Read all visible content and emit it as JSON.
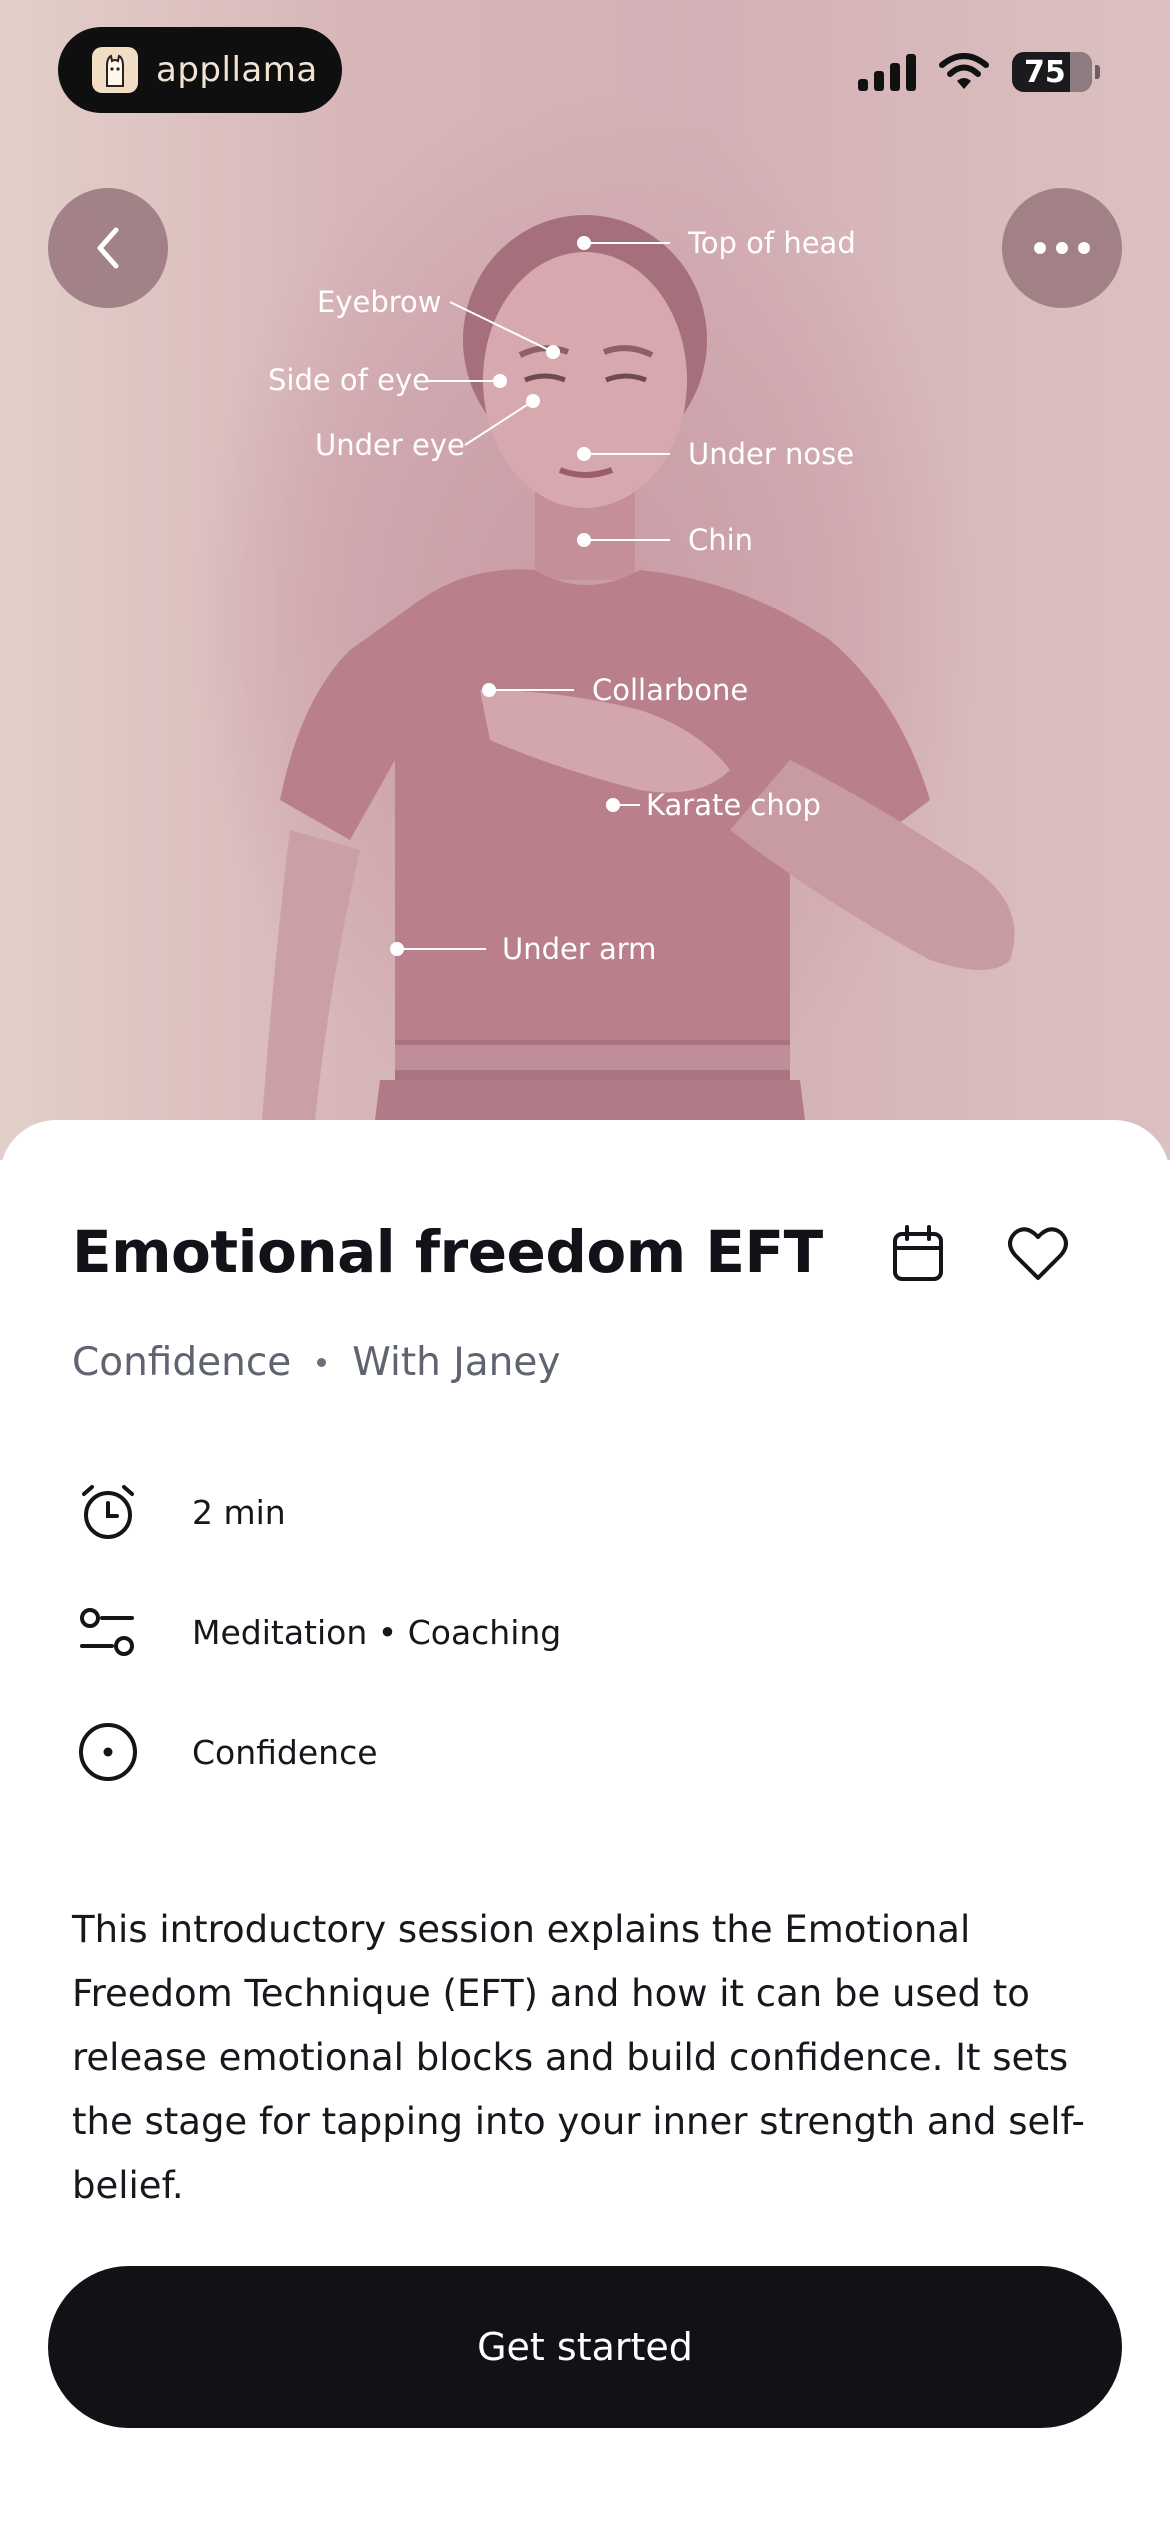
{
  "status_bar": {
    "brand": "appllama",
    "battery": "75"
  },
  "hero": {
    "tapping_points": [
      "Top of head",
      "Eyebrow",
      "Side of eye",
      "Under eye",
      "Under nose",
      "Chin",
      "Collarbone",
      "Karate chop",
      "Under arm"
    ]
  },
  "session": {
    "title": "Emotional freedom EFT",
    "category": "Confidence",
    "instructor": "With Janey",
    "duration": "2 min",
    "type": "Meditation • Coaching",
    "goal": "Confidence",
    "description": "This introductory session explains the Emotional Freedom Technique (EFT) and how it can be used to release emotional blocks and build confidence. It sets the stage for tapping into your inner strength and self-belief.",
    "cta": "Get started"
  },
  "icons": {
    "back": "chevron-left-icon",
    "more": "more-dots-icon",
    "calendar": "calendar-icon",
    "favorite": "heart-icon",
    "duration": "alarm-clock-icon",
    "type": "sliders-icon",
    "goal": "target-icon"
  },
  "colors": {
    "hero_tint": "#cfa7ae",
    "button_dark": "#111215",
    "secondary_text": "#5f6470"
  }
}
